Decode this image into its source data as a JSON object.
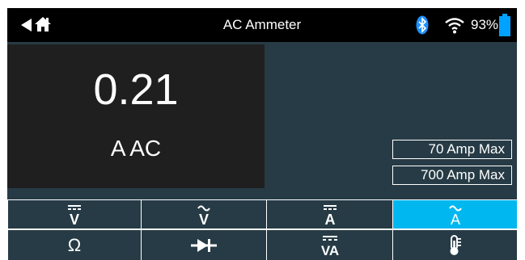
{
  "header": {
    "title": "AC Ammeter",
    "battery_percent": "93%",
    "back_icon": "back-arrow-icon",
    "home_icon": "home-icon",
    "bluetooth_icon": "bluetooth-icon",
    "wifi_icon": "wifi-icon",
    "battery_icon": "battery-icon",
    "battery_level": 0.93
  },
  "display": {
    "reading": "0.21",
    "unit": "A AC"
  },
  "ranges": [
    {
      "label": "70 Amp Max"
    },
    {
      "label": "700 Amp Max"
    }
  ],
  "modes": [
    {
      "symbol": "V",
      "icon": "dc-voltage-icon"
    },
    {
      "symbol": "V",
      "icon": "ac-voltage-icon"
    },
    {
      "symbol": "A",
      "icon": "dc-current-icon"
    },
    {
      "symbol": "A",
      "icon": "ac-current-icon",
      "active": true
    },
    {
      "symbol": "Ω",
      "icon": "resistance-icon"
    },
    {
      "symbol": "",
      "icon": "diode-icon"
    },
    {
      "symbol": "VA",
      "icon": "dc-volt-amp-icon"
    },
    {
      "symbol": "",
      "icon": "temperature-icon"
    }
  ],
  "colors": {
    "background": "#263b45",
    "titlebar": "#000000",
    "display": "#1f1f1f",
    "active": "#00b7ef",
    "text": "#ffffff"
  }
}
